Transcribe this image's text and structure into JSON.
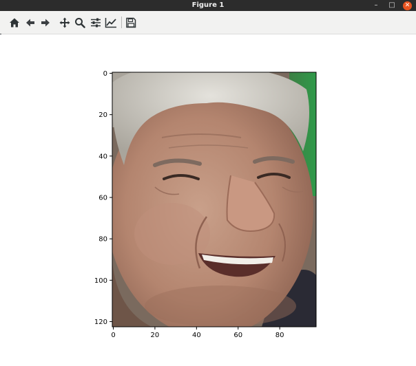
{
  "window": {
    "title": "Figure 1",
    "minimize_glyph": "–",
    "maximize_glyph": "□",
    "close_glyph": "✕",
    "close_color": "#e95420"
  },
  "toolbar": {
    "buttons": [
      {
        "name": "home-icon",
        "tooltip": "Reset original view"
      },
      {
        "name": "back-arrow-icon",
        "tooltip": "Back to previous view"
      },
      {
        "name": "forward-arrow-icon",
        "tooltip": "Forward to next view"
      },
      {
        "name": "pan-move-icon",
        "tooltip": "Pan axes"
      },
      {
        "name": "zoom-magnifier-icon",
        "tooltip": "Zoom to rectangle"
      },
      {
        "name": "configure-subplots-icon",
        "tooltip": "Configure subplots"
      },
      {
        "name": "edit-axis-icon",
        "tooltip": "Edit axis, curve and image parameters"
      },
      {
        "name": "save-floppy-icon",
        "tooltip": "Save the figure"
      }
    ]
  },
  "plot": {
    "image_description": "Close-up photo of a smiling older man with gray hair against a green background",
    "x_ticks": [
      "0",
      "20",
      "40",
      "60",
      "80"
    ],
    "y_ticks": [
      "0",
      "20",
      "40",
      "60",
      "80",
      "100",
      "120"
    ],
    "x_tick_values": [
      0,
      20,
      40,
      60,
      80
    ],
    "y_tick_values": [
      0,
      20,
      40,
      60,
      80,
      100,
      120
    ],
    "xlim": [
      -0.5,
      97.5
    ],
    "ylim": [
      122.5,
      -0.5
    ]
  },
  "colors": {
    "titlebar_bg": "#2c2c2c",
    "toolbar_bg": "#f2f2f1",
    "icon_color": "#2e3436",
    "skin_base": "#b98a74",
    "hair": "#c9c7c2",
    "background_green": "#3a8f4a",
    "shirt_dark": "#2a2a34"
  }
}
